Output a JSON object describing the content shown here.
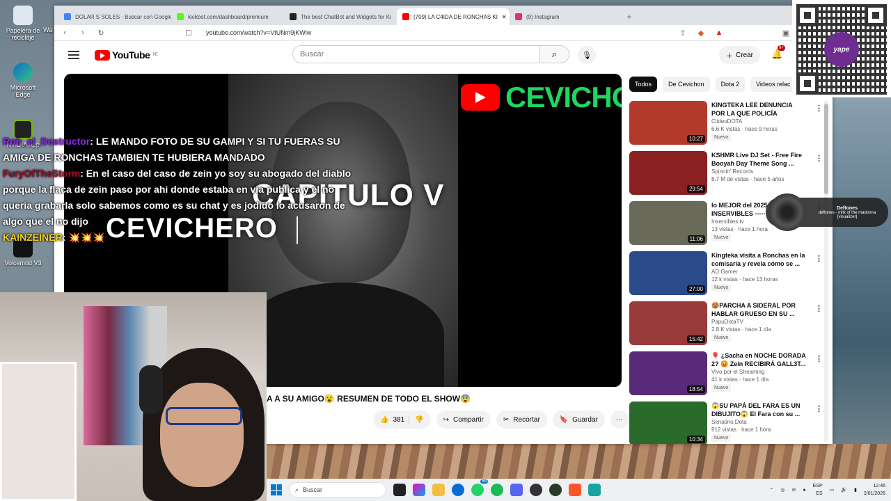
{
  "desktop": {
    "icons": [
      {
        "label": "Papelera de reciclaje"
      },
      {
        "label": "Microsoft Edge"
      },
      {
        "label": "NVIDIA App"
      },
      {
        "label": "Voicemod V3"
      }
    ],
    "partial_label": "Wa"
  },
  "browser": {
    "tabs": [
      {
        "title": "DOLAR S SOLES - Buscar con Google",
        "color": "#4285f4"
      },
      {
        "title": "kickbot.com/dashboard/premium",
        "color": "#53fc18"
      },
      {
        "title": "The best ChatBot and Widgets for Ki",
        "color": "#222222"
      },
      {
        "title": "(709) LA C4IDA DE RONCHAS KI",
        "color": "#ff0000",
        "active": true
      },
      {
        "title": "(9) Instagram",
        "color": "#e1306c"
      }
    ],
    "url": "youtube.com/watch?v=VtUNm9jKWiw"
  },
  "youtube": {
    "logo": "YouTube",
    "country": "PE",
    "search_placeholder": "Buscar",
    "create_label": "Crear",
    "notif_count": "9+",
    "video_overlay_line1": "CAPITULO V",
    "video_overlay_line2": "CEVICHERO",
    "channel_banner": "CEVICHON",
    "video_title_fragment": "A A SU AMIGO😮 RESUMEN DE TODO EL SHOW😨",
    "like_count": "381",
    "share_label": "Compartir",
    "clip_label": "Recortar",
    "save_label": "Guardar",
    "chips": [
      "Todos",
      "De Cevichon",
      "Dota 2",
      "Videos relac"
    ],
    "related": [
      {
        "title": "KINGTEKA LEE DENUNCIA POR LA QUE POLICÍA NTERVINO A ...",
        "channel": "ClideoDOTA",
        "meta": "6.6 K vistas · hace 9 horas",
        "badge": "Nuevo",
        "duration": "10:27",
        "thumb": "#b33a2a"
      },
      {
        "title": "KSHMR Live DJ Set - Free Fire Booyah Day Theme Song ...",
        "channel": "Spinnin' Records",
        "meta": "8.7 M de vistas · hace 5 años",
        "badge": "",
        "duration": "29:54",
        "thumb": "#8a2020"
      },
      {
        "title": "lo MEJOR del 2025 de INSERVIBLES -----",
        "channel": "Inservibles tv",
        "meta": "13 vistas · hace 1 hora",
        "badge": "Nuevo",
        "duration": "11:06",
        "thumb": "#6a6a5a"
      },
      {
        "title": "Kingteka visita a Ronchas en la comisaría y revela cómo se ...",
        "channel": "AD Gamer",
        "meta": "12 k vistas · hace 13 horas",
        "badge": "Nuevo",
        "duration": "27:00",
        "thumb": "#2a4a8a"
      },
      {
        "title": "🥵PARCHA A SIDERAL POR HABLAR GRUESO EN SU ...",
        "channel": "PapuDotaTV",
        "meta": "2.8 K vistas · hace 1 día",
        "badge": "Nuevo",
        "duration": "15:42",
        "thumb": "#9a3a3a"
      },
      {
        "title": "🎈 ¿Sacha en NOCHE DORADA 2? 😡 Zein RECIBIRÁ GALL3T...",
        "channel": "Vivo por el Streaming",
        "meta": "41 k vistas · hace 1 día",
        "badge": "Nuevo",
        "duration": "18:54",
        "thumb": "#5a2a7a"
      },
      {
        "title": "😱SU PAPÁ DEL FARA ES UN DIBUJITO😱 El Fara con su ...",
        "channel": "Senatino Dota",
        "meta": "912 vistas · hace 1 hora",
        "badge": "Nuevo",
        "duration": "10:34",
        "thumb": "#2a6a2a"
      }
    ]
  },
  "chat": [
    {
      "user": "Rob_el_Destructor",
      "text": ": LE MANDO FOTO DE SU GAMPI Y SI TU FUERAS SU AMIGA DE RONCHAS TAMBIEN TE HUBIERA MANDADO"
    },
    {
      "user": "FuryOfTheStorm",
      "text": ": En el caso del caso de zein yo soy su abogado del diablo porque la flaca de zein paso por ahi donde estaba en via publica y el no queria grabarla solo sabemos como es su chat y es jodido lo acusaron de algo que el no dijo"
    },
    {
      "user": "KAINZEINER",
      "text": ": 💥💥💥"
    }
  ],
  "music_widget": {
    "artist": "Deftones",
    "track": "deftones - milk of the madonna [visualizer]"
  },
  "qr": {
    "brand": "yape"
  },
  "taskbar": {
    "search_placeholder": "Buscar",
    "whatsapp_badge": "59",
    "lang": "ESP",
    "lang_sub": "ES",
    "time": "12:46",
    "date": "2/01/2026"
  }
}
